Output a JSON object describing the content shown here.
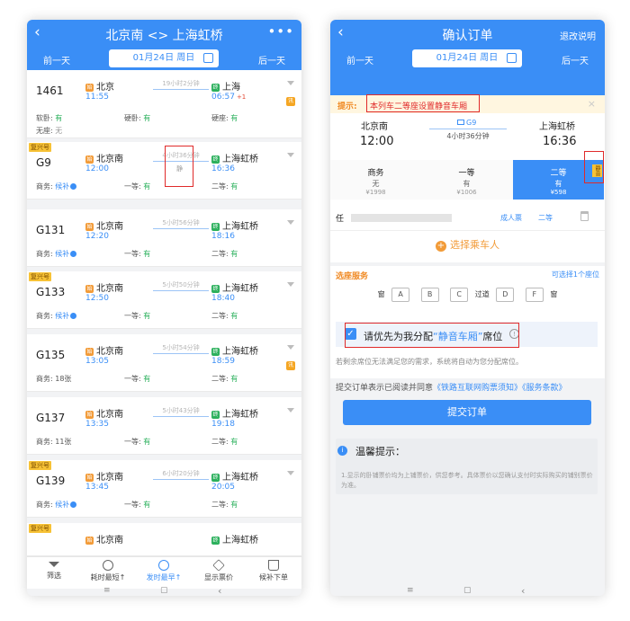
{
  "left": {
    "back_glyph": "‹",
    "title": "北京南 <> 上海虹桥",
    "more_glyph": "•••",
    "prev_day": "前一天",
    "next_day": "后一天",
    "date": "01月24日 周日",
    "trains": [
      {
        "tag": "",
        "no": "1461",
        "from": "北京",
        "from_icon": "始",
        "dep": "11:55",
        "dur": "19小时2分钟",
        "to": "上海",
        "to_icon": "终",
        "arr": "06:57",
        "plus": "+1",
        "badge": "讯",
        "seats": [
          {
            "label": "软卧:",
            "value": "有"
          },
          {
            "label": "硬卧:",
            "value": "有"
          },
          {
            "label": "硬座:",
            "value": "有"
          }
        ],
        "seats2": [
          {
            "label": "无座:",
            "value": "无"
          }
        ]
      },
      {
        "tag": "复兴号",
        "no": "G9",
        "from": "北京南",
        "from_icon": "始",
        "dep": "12:00",
        "dur": "4小时36分钟",
        "to": "上海虹桥",
        "to_icon": "终",
        "arr": "16:36",
        "plus": "",
        "badge": "",
        "quiet": "静",
        "seats": [
          {
            "label": "商务:",
            "value": "候补"
          },
          {
            "label": "一等:",
            "value": "有"
          },
          {
            "label": "二等:",
            "value": "有"
          }
        ]
      },
      {
        "tag": "",
        "no": "G131",
        "from": "北京南",
        "from_icon": "始",
        "dep": "12:20",
        "dur": "5小时56分钟",
        "to": "上海虹桥",
        "to_icon": "终",
        "arr": "18:16",
        "plus": "",
        "badge": "",
        "seats": [
          {
            "label": "商务:",
            "value": "候补"
          },
          {
            "label": "一等:",
            "value": "有"
          },
          {
            "label": "二等:",
            "value": "有"
          }
        ]
      },
      {
        "tag": "复兴号",
        "no": "G133",
        "from": "北京南",
        "from_icon": "始",
        "dep": "12:50",
        "dur": "5小时50分钟",
        "to": "上海虹桥",
        "to_icon": "终",
        "arr": "18:40",
        "plus": "",
        "badge": "",
        "seats": [
          {
            "label": "商务:",
            "value": "候补"
          },
          {
            "label": "一等:",
            "value": "有"
          },
          {
            "label": "二等:",
            "value": "有"
          }
        ]
      },
      {
        "tag": "",
        "no": "G135",
        "from": "北京南",
        "from_icon": "始",
        "dep": "13:05",
        "dur": "5小时54分钟",
        "to": "上海虹桥",
        "to_icon": "终",
        "arr": "18:59",
        "plus": "",
        "badge": "讯",
        "seats": [
          {
            "label": "商务:",
            "value": "18张"
          },
          {
            "label": "一等:",
            "value": "有"
          },
          {
            "label": "二等:",
            "value": "有"
          }
        ]
      },
      {
        "tag": "",
        "no": "G137",
        "from": "北京南",
        "from_icon": "始",
        "dep": "13:35",
        "dur": "5小时43分钟",
        "to": "上海虹桥",
        "to_icon": "终",
        "arr": "19:18",
        "plus": "",
        "badge": "",
        "seats": [
          {
            "label": "商务:",
            "value": "11张"
          },
          {
            "label": "一等:",
            "value": "有"
          },
          {
            "label": "二等:",
            "value": "有"
          }
        ]
      },
      {
        "tag": "复兴号",
        "no": "G139",
        "from": "北京南",
        "from_icon": "始",
        "dep": "13:45",
        "dur": "6小时20分钟",
        "to": "上海虹桥",
        "to_icon": "终",
        "arr": "20:05",
        "plus": "",
        "badge": "",
        "seats": [
          {
            "label": "商务:",
            "value": "候补"
          },
          {
            "label": "一等:",
            "value": "有"
          },
          {
            "label": "二等:",
            "value": "有"
          }
        ]
      },
      {
        "tag": "复兴号",
        "no": "",
        "from": "北京南",
        "from_icon": "始",
        "dep": "",
        "dur": "",
        "to": "上海虹桥",
        "to_icon": "终",
        "arr": "",
        "plus": "",
        "badge": "",
        "seats": []
      }
    ],
    "tabs": [
      "筛选",
      "耗时最短↑",
      "发时最早↑",
      "显示票价",
      "候补下单"
    ],
    "nav": [
      "≡",
      "▢",
      "‹"
    ]
  },
  "right": {
    "back_glyph": "‹",
    "title": "确认订单",
    "refund": "退改说明",
    "prev_day": "前一天",
    "next_day": "后一天",
    "date": "01月24日 周日",
    "tip_label": "提示:",
    "tip_text": "本列车二等座设置静音车厢",
    "tip_close": "×",
    "from": "北京南",
    "dep": "12:00",
    "train_no": "G9",
    "duration": "4小时36分钟",
    "to": "上海虹桥",
    "arr": "16:36",
    "options": [
      {
        "name": "商务",
        "status": "无",
        "price": "¥1998"
      },
      {
        "name": "一等",
        "status": "有",
        "price": "¥1006"
      },
      {
        "name": "二等",
        "status": "有",
        "price": "¥598"
      }
    ],
    "quiet_badge": "静音",
    "passenger_name": "任",
    "ticket_type": "成人票",
    "seat_class": "二等",
    "add_passenger": "选择乘车人",
    "seat_title": "选座服务",
    "seat_hint": "可选择1个座位",
    "window": "窗",
    "aisle": "过道",
    "seats": [
      "A",
      "B",
      "C",
      "D",
      "F"
    ],
    "quiet_pref_prefix": "请优先为我分配",
    "quiet_pref_link": "“静音车厢”",
    "quiet_pref_suffix": "席位",
    "fallback": "若剩余席位无法满足您的需求，系统将自动为您分配席位。",
    "agree_prefix": "提交订单表示已阅读并同意",
    "agree_links": "《铁路互联网购票须知》《服务条款》",
    "submit": "提交订单",
    "warm_title": "温馨提示：",
    "warm_text": "1.显示的卧铺票价均为上铺票价，供您参考。具体票价以您确认支付时实际购买的铺别票价为准。",
    "nav": [
      "≡",
      "▢",
      "‹"
    ]
  }
}
